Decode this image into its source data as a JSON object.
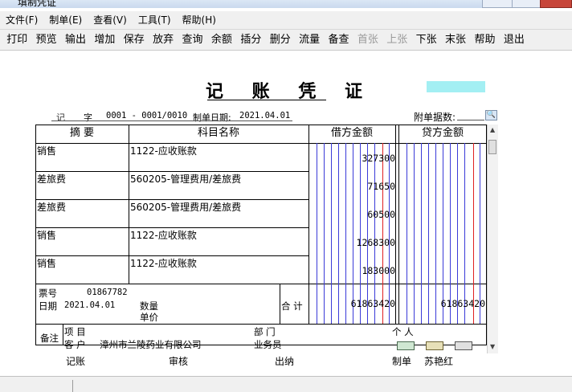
{
  "window": {
    "title": "填制凭证"
  },
  "menu": [
    "文件(F)",
    "制单(E)",
    "查看(V)",
    "工具(T)",
    "帮助(H)"
  ],
  "toolbar": [
    {
      "label": "打印",
      "enabled": true
    },
    {
      "label": "预览",
      "enabled": true
    },
    {
      "label": "输出",
      "enabled": true
    },
    {
      "label": "增加",
      "enabled": true
    },
    {
      "label": "保存",
      "enabled": true
    },
    {
      "label": "放弃",
      "enabled": true
    },
    {
      "label": "查询",
      "enabled": true
    },
    {
      "label": "余额",
      "enabled": true
    },
    {
      "label": "插分",
      "enabled": true
    },
    {
      "label": "删分",
      "enabled": true
    },
    {
      "label": "流量",
      "enabled": true
    },
    {
      "label": "备查",
      "enabled": true
    },
    {
      "label": "首张",
      "enabled": false
    },
    {
      "label": "上张",
      "enabled": false
    },
    {
      "label": "下张",
      "enabled": true
    },
    {
      "label": "末张",
      "enabled": true
    },
    {
      "label": "帮助",
      "enabled": true
    },
    {
      "label": "退出",
      "enabled": true
    }
  ],
  "voucher": {
    "title": "记 账 凭 证",
    "type": "记",
    "zi": "字",
    "number": "0001 - 0001/0010",
    "date_label": "制单日期:",
    "date": "2021.04.01",
    "attach_label": "附单据数:",
    "col_summary": "摘  要",
    "col_account": "科目名称",
    "col_debit": "借方金额",
    "col_credit": "贷方金额",
    "rows": [
      {
        "summary": "销售",
        "account": "1122-应收账款",
        "debit": "327300",
        "credit": ""
      },
      {
        "summary": "差旅费",
        "account": "560205-管理费用/差旅费",
        "debit": "71650",
        "credit": ""
      },
      {
        "summary": "差旅费",
        "account": "560205-管理费用/差旅费",
        "debit": "60500",
        "credit": ""
      },
      {
        "summary": "销售",
        "account": "1122-应收账款",
        "debit": "1268300",
        "credit": ""
      },
      {
        "summary": "销售",
        "account": "1122-应收账款",
        "debit": "183000",
        "credit": ""
      }
    ],
    "bill_label": "票号",
    "bill_no": "01867782",
    "date2_label": "日期",
    "date2": "2021.04.01",
    "qty_label": "数量",
    "price_label": "单价",
    "total_label": "合 计",
    "total_debit": "61863420",
    "total_credit": "61863420",
    "remark_label": "备注",
    "project_label": "项  目",
    "dept_label": "部  门",
    "person_label": "个  人",
    "customer_label": "客  户",
    "customer": "漳州市兰陵药业有限公司",
    "staff_label": "业务员",
    "sign": {
      "bookkeep": "记账",
      "review": "审核",
      "cashier": "出纳",
      "maker_label": "制单",
      "maker": "苏艳红"
    }
  }
}
